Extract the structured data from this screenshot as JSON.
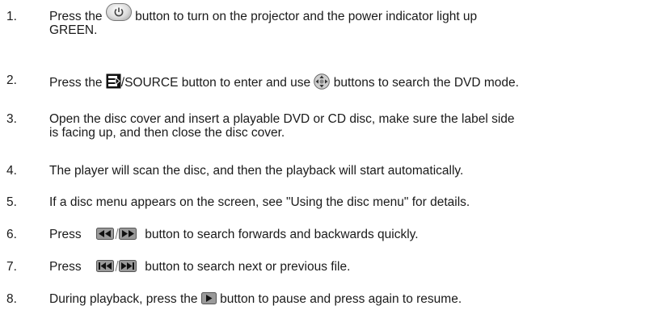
{
  "steps": [
    {
      "num": "1.",
      "before": "Press the ",
      "after": " button to turn on the projector and the power indicator light up",
      "line2": "GREEN."
    },
    {
      "num": "2.",
      "before": "Press the ",
      "middle": "/SOURCE button to enter and use ",
      "after": " buttons to search the DVD mode."
    },
    {
      "num": "3.",
      "text": "Open the disc cover and insert a playable DVD or CD disc, make sure the label side",
      "line2": "is facing up, and then close the disc cover."
    },
    {
      "num": "4.",
      "text": "The player will scan the disc, and then the playback will start automatically."
    },
    {
      "num": "5.",
      "text": "If a disc menu appears on the screen, see \"Using the disc menu\" for details."
    },
    {
      "num": "6.",
      "before": "Press ",
      "after": " button to search forwards and backwards quickly."
    },
    {
      "num": "7.",
      "before": "Press ",
      "after": " button to search next or previous file."
    },
    {
      "num": "8.",
      "before": "During playback, press the ",
      "after": " button to pause and press again to resume."
    }
  ],
  "icons": {
    "power": "power-button-icon",
    "source": "source-button-icon",
    "navigation": "navigation-pad-icon",
    "seek": "rewind-fast-forward-buttons-icon",
    "skip": "previous-next-buttons-icon",
    "play": "play-pause-button-icon"
  }
}
